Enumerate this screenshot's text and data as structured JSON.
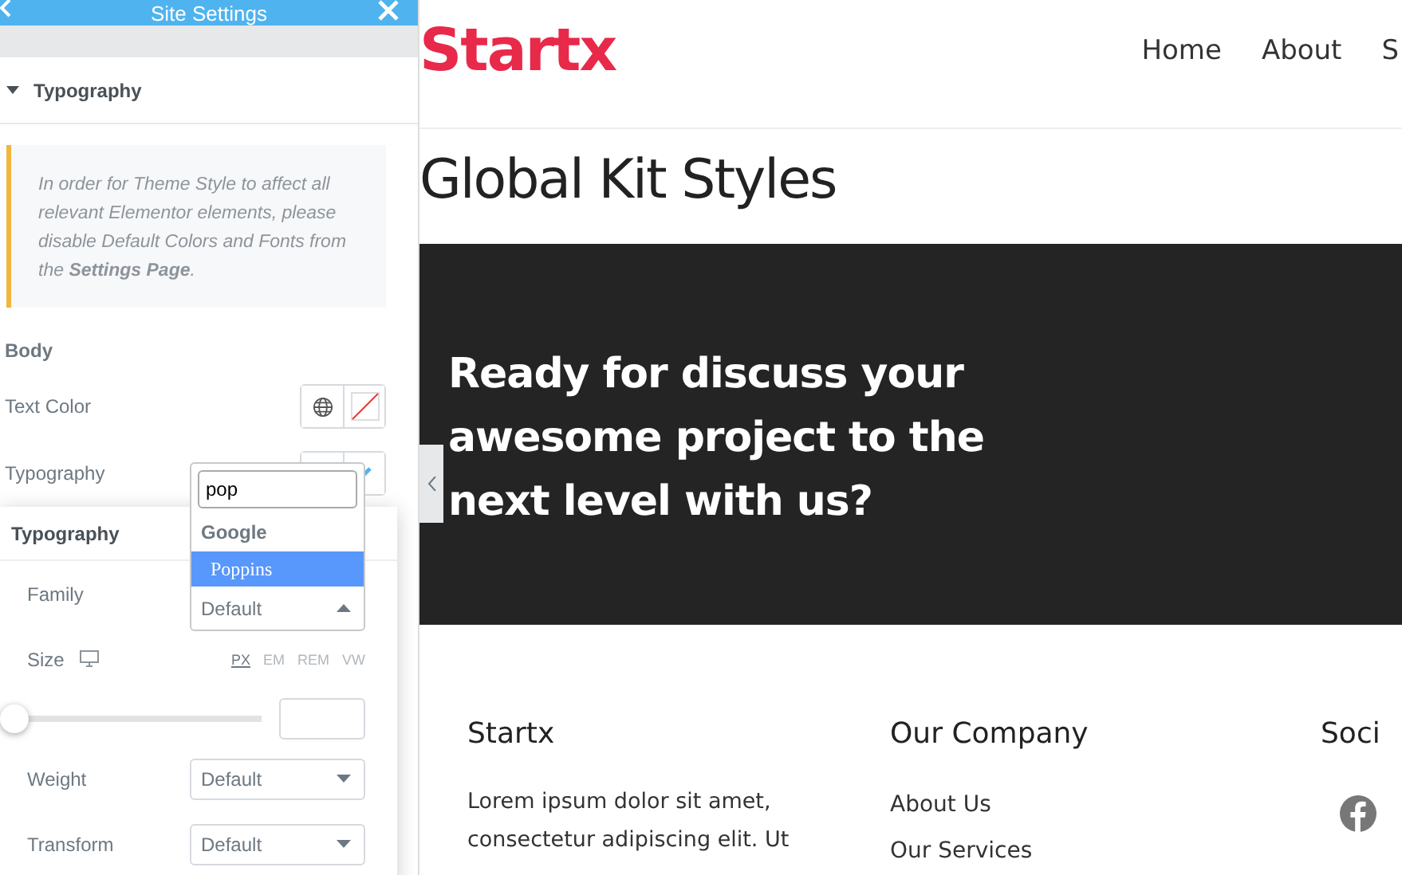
{
  "panel": {
    "title": "Site Settings",
    "section": {
      "title": "Typography",
      "expanded": true
    },
    "notice": "In order for Theme Style to affect all relevant Elementor elements, please disable Default Colors and Fonts from the **Settings Page**.",
    "group": "Body",
    "rows": [
      {
        "kind": "color",
        "label": "Text Color"
      },
      {
        "kind": "typography",
        "label": "Typography",
        "editing": true
      }
    ]
  },
  "popover": {
    "title": "Typography",
    "fields": [
      {
        "kind": "select",
        "label": "Family",
        "value": "Default",
        "open": true
      },
      {
        "kind": "slider",
        "label": "Size",
        "units": [
          {
            "label": "PX",
            "selected": true
          },
          {
            "label": "EM",
            "selected": false
          },
          {
            "label": "REM",
            "selected": false
          },
          {
            "label": "VW",
            "selected": false
          }
        ],
        "level": 0
      },
      {
        "kind": "select",
        "label": "Weight",
        "value": "Default",
        "open": false
      },
      {
        "kind": "select",
        "label": "Transform",
        "value": "Default",
        "open": false
      }
    ]
  },
  "dropdown": {
    "search": "pop",
    "group": "Google",
    "options": [
      {
        "label": "Poppins",
        "selected": true
      }
    ]
  },
  "site": {
    "logo": "Startx",
    "nav": [
      "Home",
      "About",
      "S"
    ],
    "page_title": "Global Kit Styles",
    "hero": [
      "Ready for discuss your",
      "awesome project to the",
      "next level with us?"
    ],
    "footer": [
      {
        "kind": "text",
        "title": "Startx",
        "lines": [
          "Lorem ipsum dolor sit amet,",
          "consectetur adipiscing elit. Ut"
        ]
      },
      {
        "kind": "links",
        "title": "Our Company",
        "lines": [
          "About Us",
          "Our Services"
        ]
      },
      {
        "kind": "social",
        "title": "Soci"
      }
    ]
  }
}
